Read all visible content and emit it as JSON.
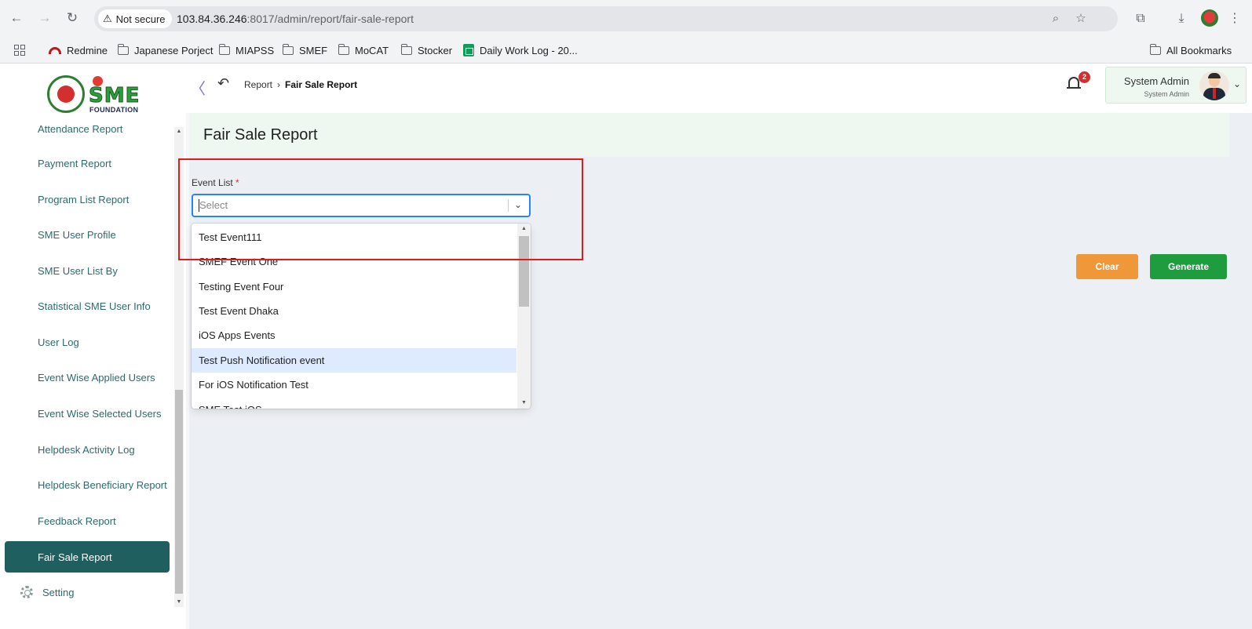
{
  "browser": {
    "not_secure": "Not secure",
    "url_host": "103.84.36.246",
    "url_rest": ":8017/admin/report/fair-sale-report",
    "bookmarks": [
      "Redmine",
      "Japanese Porject",
      "MIAPSS",
      "SMEF",
      "MoCAT",
      "Stocker",
      "Daily Work Log - 20..."
    ],
    "all_bookmarks": "All Bookmarks"
  },
  "logo": {
    "text": "SME",
    "sub": "FOUNDATION"
  },
  "sidebar": {
    "items": [
      "Attendance Report",
      "Payment Report",
      "Program List Report",
      "SME User Profile",
      "SME User List By",
      "Statistical SME User Info",
      "User Log",
      "Event Wise Applied Users",
      "Event Wise Selected Users",
      "Helpdesk Activity Log",
      "Helpdesk Beneficiary Report",
      "Feedback Report",
      "Fair Sale Report"
    ],
    "active_index": 12,
    "setting": "Setting"
  },
  "header": {
    "breadcrumb_root": "Report",
    "breadcrumb_current": "Fair Sale Report",
    "notification_count": "2",
    "user_name": "System Admin",
    "user_role": "System Admin"
  },
  "page": {
    "title": "Fair Sale Report",
    "event_label": "Event List",
    "required_mark": "*",
    "select_placeholder": "Select",
    "options": [
      "Test Event111",
      "SMEF Event One",
      "Testing Event Four",
      "Test Event Dhaka",
      "iOS Apps Events",
      "Test Push Notification event",
      "For iOS Notification Test",
      "SME Test iOS"
    ],
    "highlighted_option_index": 5,
    "clear_label": "Clear",
    "generate_label": "Generate"
  },
  "colors": {
    "sidebar_active": "#1f5f5f",
    "clear_button": "#f0973a",
    "generate_button": "#1f9d3e",
    "highlight_frame": "#e01b1b"
  }
}
